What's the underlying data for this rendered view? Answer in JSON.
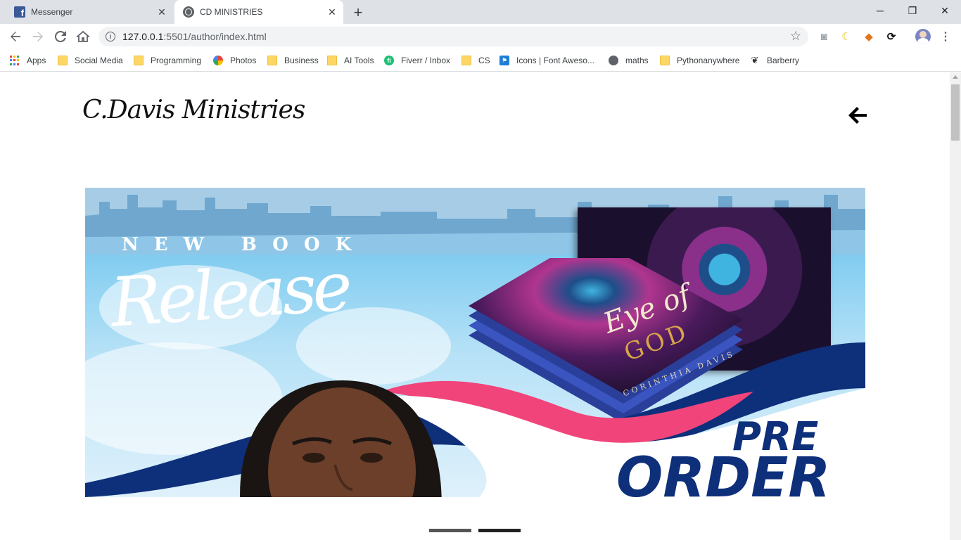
{
  "browser": {
    "tabs": [
      {
        "title": "Messenger",
        "active": false,
        "favicon": "facebook-icon"
      },
      {
        "title": "CD MINISTRIES",
        "active": true,
        "favicon": "globe-icon"
      }
    ],
    "url_host": "127.0.0.1",
    "url_rest": ":5501/author/index.html",
    "bookmarks": [
      {
        "label": "Apps",
        "icon": "apps-grid-icon"
      },
      {
        "label": "Social Media",
        "icon": "folder-icon"
      },
      {
        "label": "Programming",
        "icon": "folder-icon"
      },
      {
        "label": "Photos",
        "icon": "photos-icon"
      },
      {
        "label": "Business",
        "icon": "folder-icon"
      },
      {
        "label": "AI Tools",
        "icon": "folder-icon"
      },
      {
        "label": "Fiverr / Inbox",
        "icon": "fiverr-icon"
      },
      {
        "label": "CS",
        "icon": "folder-icon"
      },
      {
        "label": "Icons | Font Aweso...",
        "icon": "font-awesome-icon"
      },
      {
        "label": "maths",
        "icon": "globe-icon"
      },
      {
        "label": "Pythonanywhere",
        "icon": "folder-icon"
      },
      {
        "label": "Barberry",
        "icon": "barberry-icon"
      }
    ]
  },
  "page": {
    "brand": "C.Davis Ministries",
    "banner": {
      "heading": "NEW BOOK",
      "script_text": "Release",
      "book_title_1": "Eye of",
      "book_title_2": "GOD",
      "book_author": "CORINTHIA DAVIS",
      "cta_line1": "PRE",
      "cta_line2": "ORDER"
    },
    "carousel": {
      "slides": 2,
      "active_index": 1
    },
    "colors": {
      "accent_blue": "#0e2f7a",
      "accent_pink": "#f0447a",
      "sky": "#8fd2f2"
    }
  }
}
